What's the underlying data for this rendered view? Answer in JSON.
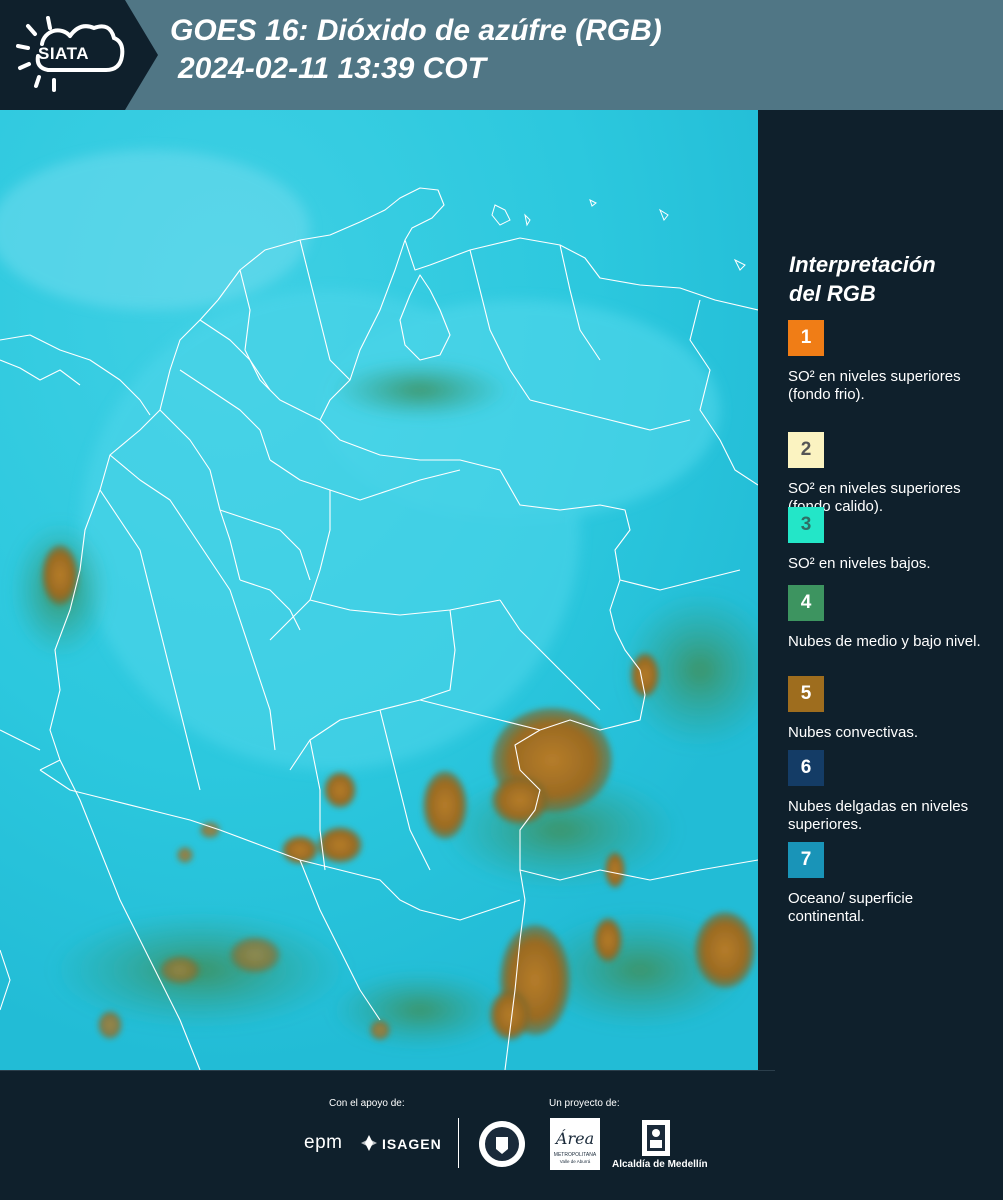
{
  "header": {
    "logo_text": "SIATA",
    "title_line1": "GOES 16: Dióxido de azúfre (RGB)",
    "title_line2": "2024-02-11 13:39 COT"
  },
  "legend": {
    "title_line1": "Interpretación",
    "title_line2": "del RGB",
    "items": [
      {
        "number": "1",
        "label": "SO² en niveles superiores (fondo frio).",
        "color": "#f07d16",
        "text_color": "#ffffff"
      },
      {
        "number": "2",
        "label": "SO² en niveles superiores (fondo calido).",
        "color": "#fbf3c1",
        "text_color": "#555555"
      },
      {
        "number": "3",
        "label": "SO² en niveles bajos.",
        "color": "#23e6c8",
        "text_color": "#2f6f65"
      },
      {
        "number": "4",
        "label": "Nubes de medio y bajo nivel.",
        "color": "#3d9460",
        "text_color": "#ffffff"
      },
      {
        "number": "5",
        "label": "Nubes convectivas.",
        "color": "#9e6d1e",
        "text_color": "#ffffff"
      },
      {
        "number": "6",
        "label": "Nubes delgadas en niveles superiores.",
        "color": "#143c66",
        "text_color": "#ffffff"
      },
      {
        "number": "7",
        "label": "Oceano/ superficie continental.",
        "color": "#1994b8",
        "text_color": "#ffffff"
      }
    ]
  },
  "map": {
    "background_color": "#27c6dc",
    "boundary_color": "#ffffff"
  },
  "footer": {
    "support_label": "Con el apoyo de:",
    "project_label": "Un proyecto de:",
    "epm_text": "epm",
    "isagen_text": "ISAGEN",
    "area_text": "Área",
    "area_sub": "METROPOLITANA",
    "area_sub2": "Valle de Aburrá",
    "alcaldia_label": "Alcaldía de Medellín"
  }
}
